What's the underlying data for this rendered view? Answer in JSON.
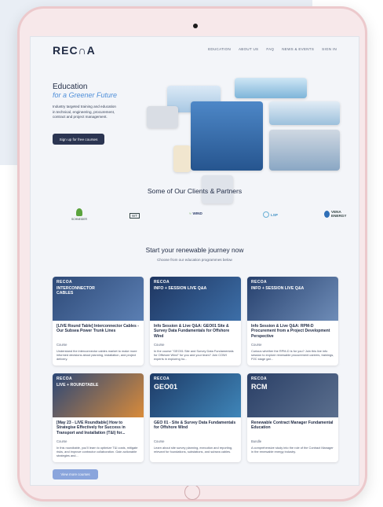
{
  "nav": {
    "logo": "REC∩A",
    "links": [
      "EDUCATION",
      "ABOUT US",
      "FAQ",
      "NEWS & EVENTS",
      "SIGN IN"
    ]
  },
  "hero": {
    "title": "Education",
    "subtitle": "for a Greener Future",
    "description": "Industry targeted training and education in technical, engineering, procurement, contract and project management.",
    "cta": "Sign up for free courses"
  },
  "clients": {
    "title": "Some of Our Clients & Partners",
    "logos": [
      "SCHNEIDER",
      "WT",
      "WIND",
      "LSP",
      "VENA ENERGY"
    ]
  },
  "journey": {
    "title": "Start your renewable journey now",
    "subtitle": "Choose from our education programmes below"
  },
  "cards": [
    {
      "thumb_brand": "RECOA",
      "thumb_heading": "INTERCONNECTOR CABLES",
      "title": "[LIVE Round Table] Interconnector Cables - Our Subsea Power Trunk Lines",
      "type": "Course",
      "desc": "Understand the interconnector cables market to make more informed decisions about planning, installation, and project delivery."
    },
    {
      "thumb_brand": "RECOA",
      "thumb_heading": "INFO + SESSION LIVE Q&A",
      "title": "Info Session & Live Q&A: GEO01 Site & Survey Data Fundamentals for Offshore Wind",
      "type": "Course",
      "desc": "In the course \"GEO01 Site and Survey Data Fundamentals for Offshore Wind\" for you and your team? Join COWI experts in exploring ho..."
    },
    {
      "thumb_brand": "RECOA",
      "thumb_heading": "INFO + SESSION LIVE Q&A",
      "title": "Info Session & Live Q&A: RPM-D Procurement from a Project Development Perspective",
      "type": "Course",
      "desc": "Curious whether the RPM-D is for you? Join this live info session to explore renewable procurement careers, trainings, P2C stage gat..."
    },
    {
      "thumb_brand": "RECOA",
      "thumb_heading": "LIVE + ROUNDTABLE",
      "title": "[May 23 - LIVE Roundtable] How to Strategise Effectively for Success in Transport and Installation (T&I) for...",
      "type": "Course",
      "desc": "In this roundtable, you'll learn to optimize T&I costs, mitigate risks, and improve contractor collaboration. Gain actionable strategies and..."
    },
    {
      "thumb_brand": "RECOA",
      "thumb_heading": "GEO01",
      "title": "GEO 01 - Site & Survey Data Fundamentals for Offshore Wind",
      "type": "Course",
      "desc": "Learn about site survey planning, execution and reporting, relevant for foundations, substations, and subsea cables."
    },
    {
      "thumb_brand": "RECOA",
      "thumb_heading": "RCM",
      "title": "Renewable Contract Manager Fundamental Education",
      "type": "Bundle",
      "desc": "A comprehensive study into the role of the Contract Manager in the renewable energy industry."
    }
  ],
  "more_button": "View more courses"
}
